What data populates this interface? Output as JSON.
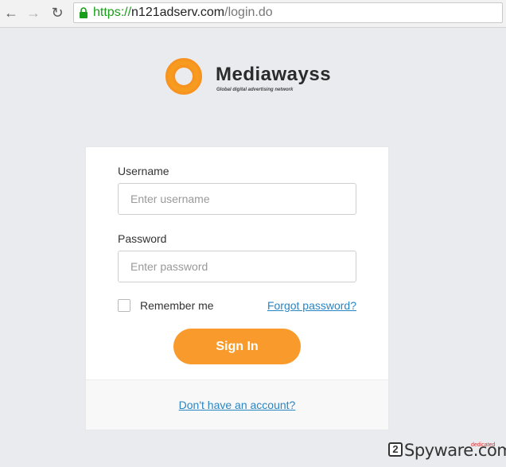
{
  "browser": {
    "url_protocol": "https://",
    "url_host": "n121adserv.com",
    "url_path": "/login.do"
  },
  "logo": {
    "name": "Mediawayss",
    "tagline": "Global digital advertising network"
  },
  "login": {
    "username_label": "Username",
    "username_placeholder": "Enter username",
    "username_value": "",
    "password_label": "Password",
    "password_placeholder": "Enter password",
    "password_value": "",
    "remember_label": "Remember me",
    "remember_checked": false,
    "forgot_link": "Forgot password?",
    "signin_button": "Sign In",
    "signup_link": "Don't have an account?"
  },
  "watermark": {
    "badge": "2",
    "text": "Spyware.com",
    "subtext": "dedicated"
  },
  "colors": {
    "accent": "#f99b2c",
    "link": "#2a85c3",
    "background": "#e9ebef",
    "secure_green": "#1a9e1a"
  }
}
